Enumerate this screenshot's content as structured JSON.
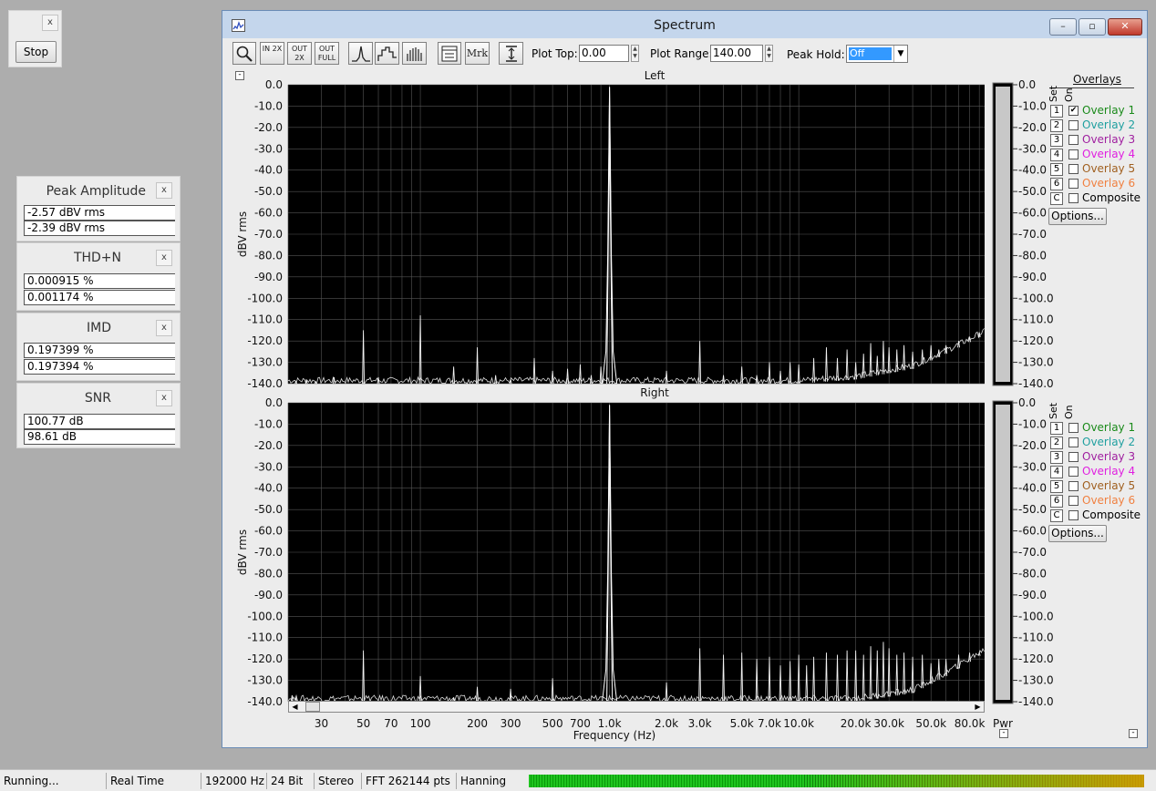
{
  "stop_panel": {
    "close": "x",
    "button": "Stop"
  },
  "meters": [
    {
      "title": "Peak Amplitude",
      "close": "x",
      "rows": [
        "-2.57 dBV rms",
        "-2.39 dBV rms"
      ]
    },
    {
      "title": "THD+N",
      "close": "x",
      "rows": [
        "0.000915 %",
        "0.001174 %"
      ]
    },
    {
      "title": "IMD",
      "close": "x",
      "rows": [
        "0.197399 %",
        "0.197394 %"
      ]
    },
    {
      "title": "SNR",
      "close": "x",
      "rows": [
        "100.77 dB",
        " 98.61 dB"
      ]
    }
  ],
  "window": {
    "title": "Spectrum",
    "controls": {
      "minimize": "–",
      "maximize": "▫",
      "close": "✕"
    }
  },
  "toolbar": {
    "zoom_in": "IN 2X",
    "zoom_out": "OUT 2X",
    "zoom_full": "OUT FULL",
    "marker": "Mrk",
    "plot_top_label": "Plot Top:",
    "plot_top_value": "0.00",
    "plot_range_label": "Plot Range:",
    "plot_range_value": "140.00",
    "peak_hold_label": "Peak Hold:",
    "peak_hold_value": "Off"
  },
  "overlays": {
    "header": "Overlays",
    "set_label": "Set",
    "on_label": "On",
    "options_button": "Options...",
    "items": [
      {
        "set": "1",
        "name": "Overlay 1",
        "color": "#1a8a1a"
      },
      {
        "set": "2",
        "name": "Overlay 2",
        "color": "#20a0a0"
      },
      {
        "set": "3",
        "name": "Overlay 3",
        "color": "#a020a0"
      },
      {
        "set": "4",
        "name": "Overlay 4",
        "color": "#e020e0"
      },
      {
        "set": "5",
        "name": "Overlay 5",
        "color": "#a06020"
      },
      {
        "set": "6",
        "name": "Overlay 6",
        "color": "#f08040"
      },
      {
        "set": "C",
        "name": "Composite",
        "color": "#000000"
      }
    ],
    "left_checked": [
      "Overlay 1"
    ]
  },
  "chart_data": [
    {
      "type": "line",
      "title": "Left",
      "ylabel": "dBV rms",
      "xscale": "log",
      "xlim": [
        20,
        96000
      ],
      "ylim": [
        -140,
        0
      ],
      "yticks": [
        "0.0",
        "-10.0",
        "-20.0",
        "-30.0",
        "-40.0",
        "-50.0",
        "-60.0",
        "-70.0",
        "-80.0",
        "-90.0",
        "-100.0",
        "-110.0",
        "-120.0",
        "-130.0",
        "-140.0"
      ],
      "grid": true,
      "series": [
        {
          "peaks": [
            [
              22,
              -139
            ],
            [
              25,
              -138
            ],
            [
              28,
              -139
            ],
            [
              35,
              -137
            ],
            [
              50,
              -115
            ],
            [
              60,
              -137
            ],
            [
              100,
              -108
            ],
            [
              150,
              -132
            ],
            [
              200,
              -123
            ],
            [
              250,
              -136
            ],
            [
              300,
              -138
            ],
            [
              400,
              -128
            ],
            [
              500,
              -134
            ],
            [
              600,
              -133
            ],
            [
              700,
              -131
            ],
            [
              800,
              -136
            ],
            [
              900,
              -132
            ],
            [
              1000,
              -1
            ],
            [
              1000,
              -25
            ],
            [
              2000,
              -134
            ],
            [
              3000,
              -120
            ],
            [
              4000,
              -136
            ],
            [
              5000,
              -132
            ],
            [
              6000,
              -136
            ],
            [
              7000,
              -130
            ],
            [
              8000,
              -134
            ],
            [
              9000,
              -130
            ],
            [
              10000,
              -131
            ],
            [
              12000,
              -128
            ],
            [
              14000,
              -123
            ],
            [
              16000,
              -128
            ],
            [
              18000,
              -124
            ],
            [
              20000,
              -130
            ],
            [
              22000,
              -126
            ],
            [
              24000,
              -121
            ],
            [
              26000,
              -127
            ],
            [
              28000,
              -120
            ],
            [
              30000,
              -123
            ],
            [
              33000,
              -124
            ],
            [
              36000,
              -122
            ],
            [
              40000,
              -125
            ],
            [
              45000,
              -124
            ],
            [
              50000,
              -122
            ],
            [
              55000,
              -124
            ],
            [
              60000,
              -122
            ],
            [
              70000,
              -120
            ],
            [
              80000,
              -118
            ],
            [
              90000,
              -116
            ]
          ],
          "floor": [
            [
              20,
              -140
            ],
            [
              10000,
              -140
            ],
            [
              20000,
              -138
            ],
            [
              40000,
              -133
            ],
            [
              60000,
              -126
            ],
            [
              96000,
              -117
            ]
          ]
        }
      ]
    },
    {
      "type": "line",
      "title": "Right",
      "ylabel": "dBV rms",
      "xlabel": "Frequency (Hz)",
      "xscale": "log",
      "xlim": [
        20,
        96000
      ],
      "ylim": [
        -140,
        0
      ],
      "xticks": [
        "30",
        "50",
        "70",
        "100",
        "200",
        "300",
        "500",
        "700",
        "1.0k",
        "2.0k",
        "3.0k",
        "5.0k",
        "7.0k",
        "10.0k",
        "20.0k",
        "30.0k",
        "50.0k",
        "80.0k"
      ],
      "xtick_values": [
        30,
        50,
        70,
        100,
        200,
        300,
        500,
        700,
        1000,
        2000,
        3000,
        5000,
        7000,
        10000,
        20000,
        30000,
        50000,
        80000
      ],
      "yticks": [
        "0.0",
        "-10.0",
        "-20.0",
        "-30.0",
        "-40.0",
        "-50.0",
        "-60.0",
        "-70.0",
        "-80.0",
        "-90.0",
        "-100.0",
        "-110.0",
        "-120.0",
        "-130.0",
        "-140.0"
      ],
      "grid": true,
      "series": [
        {
          "peaks": [
            [
              21,
              -137
            ],
            [
              22,
              -138
            ],
            [
              50,
              -116
            ],
            [
              100,
              -128
            ],
            [
              150,
              -138
            ],
            [
              200,
              -133
            ],
            [
              300,
              -134
            ],
            [
              500,
              -129
            ],
            [
              1000,
              -1
            ],
            [
              1000,
              -26
            ],
            [
              2000,
              -131
            ],
            [
              3000,
              -115
            ],
            [
              4000,
              -118
            ],
            [
              5000,
              -117
            ],
            [
              6000,
              -120
            ],
            [
              7000,
              -119
            ],
            [
              8000,
              -123
            ],
            [
              9000,
              -121
            ],
            [
              10000,
              -118
            ],
            [
              11000,
              -123
            ],
            [
              12000,
              -119
            ],
            [
              14000,
              -117
            ],
            [
              16000,
              -118
            ],
            [
              18000,
              -116
            ],
            [
              20000,
              -116
            ],
            [
              22000,
              -118
            ],
            [
              24000,
              -114
            ],
            [
              26000,
              -116
            ],
            [
              28000,
              -112
            ],
            [
              30000,
              -115
            ],
            [
              33000,
              -118
            ],
            [
              36000,
              -117
            ],
            [
              40000,
              -119
            ],
            [
              45000,
              -118
            ],
            [
              50000,
              -122
            ],
            [
              55000,
              -120
            ],
            [
              60000,
              -120
            ],
            [
              70000,
              -118
            ],
            [
              80000,
              -117
            ],
            [
              90000,
              -117
            ]
          ],
          "floor": [
            [
              20,
              -140
            ],
            [
              10000,
              -140
            ],
            [
              20000,
              -140
            ],
            [
              40000,
              -136
            ],
            [
              60000,
              -128
            ],
            [
              96000,
              -117
            ]
          ]
        }
      ]
    }
  ],
  "pwr_meter": {
    "label": "Pwr",
    "ticks": [
      "0.0",
      "-10.0",
      "-20.0",
      "-30.0",
      "-40.0",
      "-50.0",
      "-60.0",
      "-70.0",
      "-80.0",
      "-90.0",
      "-100.0",
      "-110.0",
      "-120.0",
      "-130.0",
      "-140.0"
    ]
  },
  "status": {
    "items": [
      "Running...",
      "Real Time",
      "192000 Hz",
      "24 Bit",
      "Stereo",
      "FFT 262144 pts",
      "Hanning"
    ]
  }
}
